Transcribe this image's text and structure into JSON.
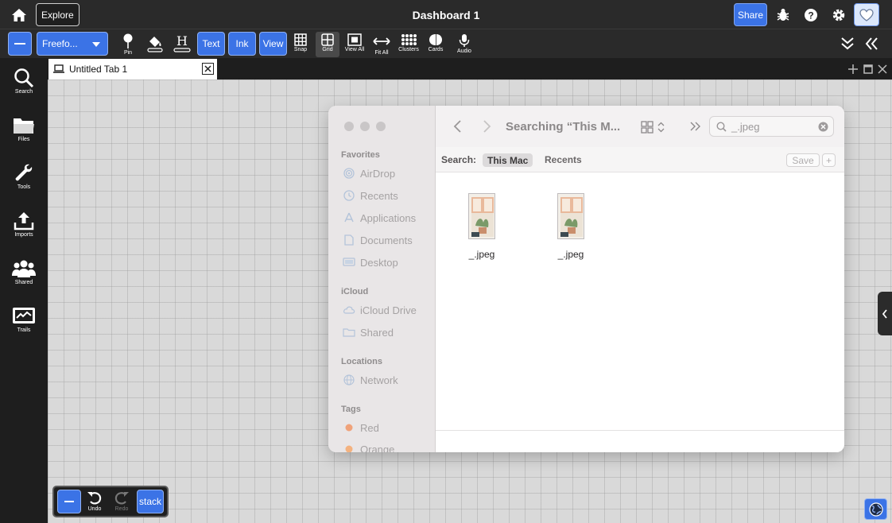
{
  "topbar": {
    "explore_label": "Explore",
    "title": "Dashboard 1",
    "share_label": "Share"
  },
  "toolbar": {
    "mode_select": "Freefo...",
    "pin_label": "Pin",
    "text_label": "Text",
    "ink_label": "Ink",
    "view_label": "View",
    "snap_label": "Snap",
    "grid_label": "Grid",
    "view_all_label": "View All",
    "fit_all_label": "Fit All",
    "clusters_label": "Clusters",
    "cards_label": "Cards",
    "audio_label": "Audio"
  },
  "sidebar": {
    "items": [
      {
        "label": "Search"
      },
      {
        "label": "Files"
      },
      {
        "label": "Tools"
      },
      {
        "label": "Imports"
      },
      {
        "label": "Shared"
      },
      {
        "label": "Trails"
      }
    ]
  },
  "tab": {
    "label": "Untitled Tab 1"
  },
  "finder": {
    "title": "Searching “This M...",
    "search_value": "_.jpeg",
    "sections": {
      "favorites": "Favorites",
      "icloud": "iCloud",
      "locations": "Locations",
      "tags": "Tags"
    },
    "favorites": [
      "AirDrop",
      "Recents",
      "Applications",
      "Documents",
      "Desktop"
    ],
    "icloud_items": [
      "iCloud Drive",
      "Shared"
    ],
    "locations_items": [
      "Network"
    ],
    "tags": [
      {
        "label": "Red",
        "color": "#f0a27a"
      },
      {
        "label": "Orange",
        "color": "#f4b27f"
      }
    ],
    "search_bar": {
      "label": "Search:",
      "scope_active": "This Mac",
      "scope_other": "Recents",
      "save_label": "Save",
      "plus_label": "+"
    },
    "files": [
      {
        "name": "_.jpeg"
      },
      {
        "name": "_.jpeg"
      }
    ]
  },
  "bottom_tools": {
    "undo_label": "Undo",
    "redo_label": "Redo",
    "stack_label": "stack"
  },
  "colors": {
    "accent": "#3b73e6",
    "canvas": "#d9d9d9",
    "chrome": "#2a2a2a"
  }
}
